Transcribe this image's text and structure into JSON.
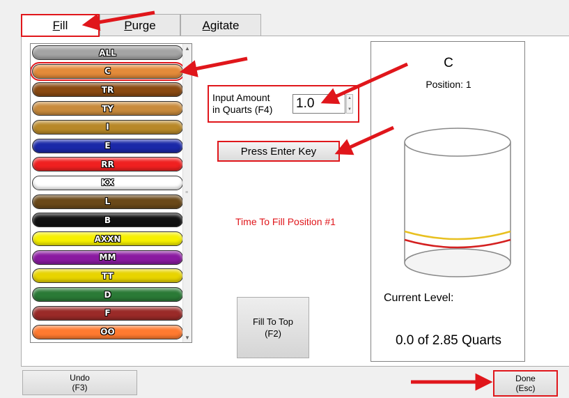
{
  "tabs": {
    "fill": {
      "first": "F",
      "rest": "ill"
    },
    "purge": {
      "first": "P",
      "rest": "urge"
    },
    "agitate": {
      "first": "A",
      "rest": "gitate"
    }
  },
  "color_list": {
    "selected": "C",
    "items": [
      {
        "label": "ALL",
        "color": "#a4a4a4"
      },
      {
        "label": "C",
        "color": "#e38b3a"
      },
      {
        "label": "TR",
        "color": "#8a4a12"
      },
      {
        "label": "TY",
        "color": "#c88a3c"
      },
      {
        "label": "I",
        "color": "#b88828"
      },
      {
        "label": "E",
        "color": "#1a28a8"
      },
      {
        "label": "RR",
        "color": "#f02020"
      },
      {
        "label": "KX",
        "color": "#ffffff"
      },
      {
        "label": "L",
        "color": "#6a4818"
      },
      {
        "label": "B",
        "color": "#111111"
      },
      {
        "label": "AXXN",
        "color": "#f6f000"
      },
      {
        "label": "MM",
        "color": "#8a1aa0"
      },
      {
        "label": "TT",
        "color": "#e8d400"
      },
      {
        "label": "D",
        "color": "#2a7a36"
      },
      {
        "label": "F",
        "color": "#9a2a28"
      },
      {
        "label": "OO",
        "color": "#ff7a30"
      }
    ]
  },
  "amount": {
    "label_line1": "Input Amount",
    "label_line2": "in Quarts (F4)",
    "value": "1.0"
  },
  "enter_button": "Press Enter Key",
  "fill_status": "Time To Fill Position #1",
  "fill_top_button": {
    "line1": "Fill To Top",
    "line2": "(F2)"
  },
  "tank": {
    "color": "C",
    "position": "Position: 1",
    "current_level_label": "Current Level:",
    "current_level_value": "0.0 of 2.85 Quarts",
    "target_line_color": "#e8c020",
    "level_line_color": "#d42020"
  },
  "undo_button": {
    "line1": "Undo",
    "line2": "(F3)"
  },
  "done_button": {
    "line1": "Done",
    "line2": "(Esc)"
  },
  "colors": {
    "annotation_red": "#e0161b"
  }
}
